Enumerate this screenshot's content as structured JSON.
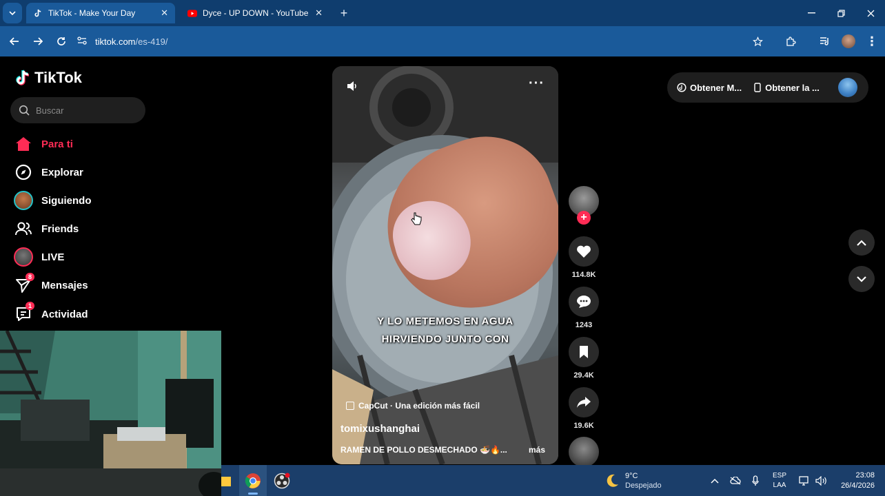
{
  "browser": {
    "tabs": [
      {
        "title": "TikTok - Make Your Day",
        "active": true
      },
      {
        "title": "Dyce - UP DOWN - YouTube",
        "active": false
      }
    ],
    "new_tab": "+",
    "url_host": "tiktok.com",
    "url_path": "/es-419/"
  },
  "sidebar": {
    "logo": "TikTok",
    "search_placeholder": "Buscar",
    "items": [
      {
        "label": "Para ti",
        "icon": "home-icon",
        "active": true
      },
      {
        "label": "Explorar",
        "icon": "compass-icon"
      },
      {
        "label": "Siguiendo",
        "icon": "following-avatar-icon"
      },
      {
        "label": "Friends",
        "icon": "friends-icon"
      },
      {
        "label": "LIVE",
        "icon": "live-avatar-icon"
      },
      {
        "label": "Mensajes",
        "icon": "messages-icon",
        "badge": "8"
      },
      {
        "label": "Actividad",
        "icon": "activity-icon",
        "badge": "1"
      }
    ]
  },
  "video": {
    "subtitle_line1": "Y LO METEMOS EN AGUA",
    "subtitle_line2": "HIRVIENDO JUNTO CON",
    "capcut": "CapCut · Una edición más fácil",
    "author": "tomixushanghai",
    "caption": "RAMEN DE POLLO DESMECHADO 🍜🔥...",
    "more": "más"
  },
  "actions": {
    "likes": "114.8K",
    "comments": "1243",
    "saves": "29.4K",
    "shares": "19.6K"
  },
  "topright": {
    "get_coins": "Obtener M...",
    "get_app": "Obtener la ..."
  },
  "taskbar": {
    "weather_temp": "9°C",
    "weather_desc": "Despejado",
    "lang_top": "ESP",
    "lang_bottom": "LAA",
    "time": "23:08",
    "date": "26/4/2026"
  },
  "colors": {
    "accent": "#fe2c55",
    "chrome_tabs": "#0f3d6e",
    "chrome_toolbar": "#1a5a9a",
    "taskbar": "#1b3e6a"
  }
}
